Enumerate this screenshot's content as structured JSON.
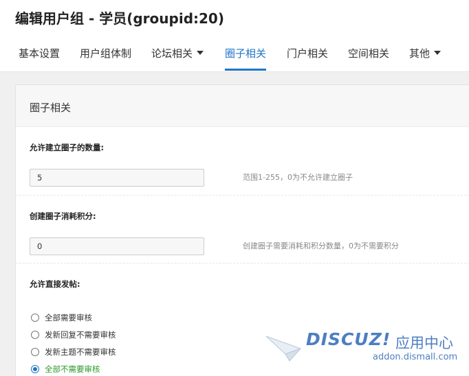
{
  "page": {
    "title": "编辑用户组 - 学员(groupid:20)"
  },
  "tabs": [
    {
      "label": "基本设置",
      "active": false,
      "dropdown": false
    },
    {
      "label": "用户组体制",
      "active": false,
      "dropdown": false
    },
    {
      "label": "论坛相关",
      "active": false,
      "dropdown": true
    },
    {
      "label": "圈子相关",
      "active": true,
      "dropdown": false
    },
    {
      "label": "门户相关",
      "active": false,
      "dropdown": false
    },
    {
      "label": "空间相关",
      "active": false,
      "dropdown": false
    },
    {
      "label": "其他",
      "active": false,
      "dropdown": true
    }
  ],
  "section": {
    "title": "圈子相关",
    "fields": [
      {
        "label": "允许建立圈子的数量:",
        "value": "5",
        "hint": "范围1-255，0为不允许建立圈子"
      },
      {
        "label": "创建圈子消耗积分:",
        "value": "0",
        "hint": "创建圈子需要消耗和积分数量，0为不需要积分"
      }
    ],
    "post_setting": {
      "label": "允许直接发帖:",
      "options": [
        {
          "label": "全部需要审核",
          "checked": false
        },
        {
          "label": "发新回复不需要审核",
          "checked": false
        },
        {
          "label": "发新主题不需要审核",
          "checked": false
        },
        {
          "label": "全部不需要审核",
          "checked": true
        }
      ]
    }
  },
  "watermark": {
    "brand": "DISCUZ!",
    "tagline": "应用中心",
    "url": "addon.dismall.com"
  },
  "colors": {
    "accent": "#1e74c7",
    "checked_text": "#2a9a2a",
    "watermark": "#3d74bd"
  }
}
